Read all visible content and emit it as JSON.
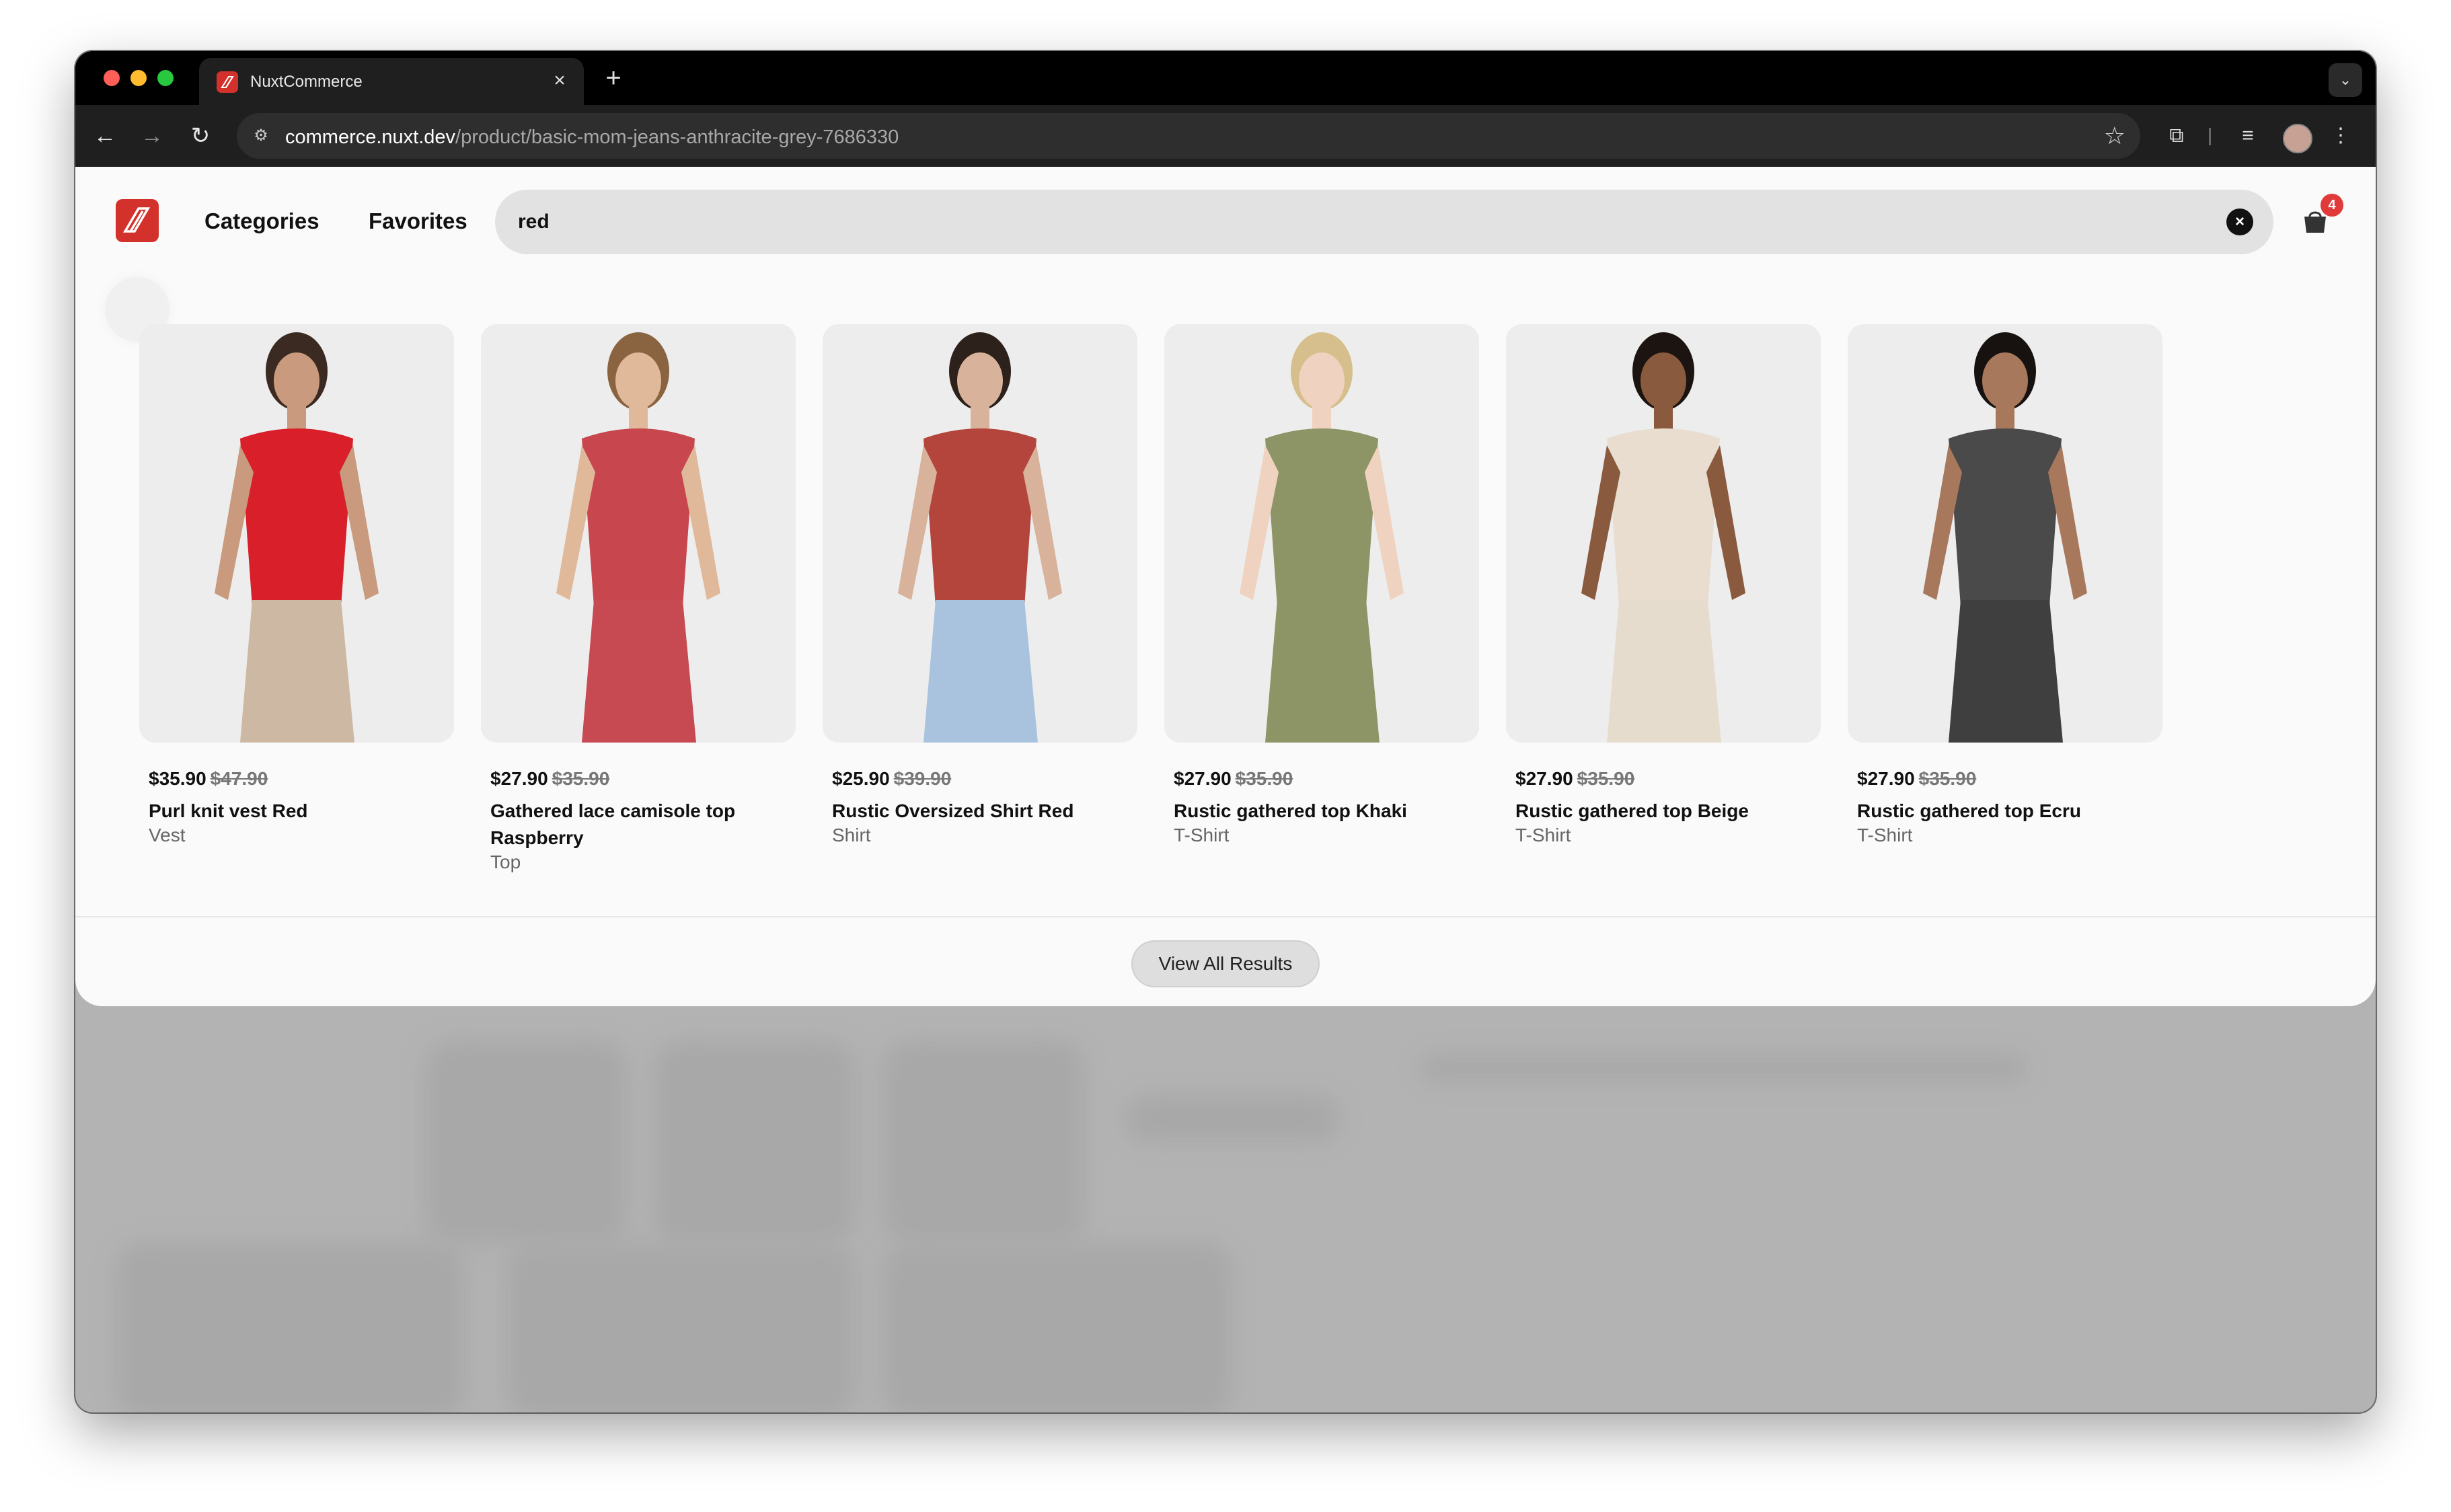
{
  "browser": {
    "tab_title": "NuxtCommerce",
    "url_host": "commerce.nuxt.dev",
    "url_path": "/product/basic-mom-jeans-anthracite-grey-7686330"
  },
  "header": {
    "nav": [
      "Categories",
      "Favorites"
    ],
    "search_value": "red",
    "cart_count": "4"
  },
  "products": [
    {
      "price": "$35.90",
      "old_price": "$47.90",
      "name": "Purl knit vest Red",
      "category": "Vest",
      "top_color": "#d81f2a",
      "bottom_color": "#cdb9a3",
      "skin": "#c99a7d",
      "hair": "#3a2a22"
    },
    {
      "price": "$27.90",
      "old_price": "$35.90",
      "name": "Gathered lace camisole top Raspberry",
      "category": "Top",
      "top_color": "#c8464e",
      "bottom_color": "#c74a53",
      "skin": "#e0b89a",
      "hair": "#8a6440"
    },
    {
      "price": "$25.90",
      "old_price": "$39.90",
      "name": "Rustic Oversized Shirt Red",
      "category": "Shirt",
      "top_color": "#b3453c",
      "bottom_color": "#a9c3de",
      "skin": "#d8b29a",
      "hair": "#2d211c"
    },
    {
      "price": "$27.90",
      "old_price": "$35.90",
      "name": "Rustic gathered top Khaki",
      "category": "T-Shirt",
      "top_color": "#8d9465",
      "bottom_color": "#8d9465",
      "skin": "#efd2bf",
      "hair": "#d6bf8c"
    },
    {
      "price": "$27.90",
      "old_price": "$35.90",
      "name": "Rustic gathered top Beige",
      "category": "T-Shirt",
      "top_color": "#e8ddcf",
      "bottom_color": "#e6dccd",
      "skin": "#8a5a3e",
      "hair": "#1c1410"
    },
    {
      "price": "$27.90",
      "old_price": "$35.90",
      "name": "Rustic gathered top Ecru",
      "category": "T-Shirt",
      "top_color": "#4a4a4a",
      "bottom_color": "#3f3f3f",
      "skin": "#a8785c",
      "hair": "#171210"
    }
  ],
  "view_all_label": "View All Results",
  "icons": [
    "close-icon",
    "plus-icon",
    "chevron-down-icon",
    "back-arrow-icon",
    "forward-arrow-icon",
    "reload-icon",
    "site-info-icon",
    "star-icon",
    "extensions-icon",
    "media-icon",
    "kebab-menu-icon",
    "logo-icon",
    "clear-icon",
    "cart-icon"
  ]
}
